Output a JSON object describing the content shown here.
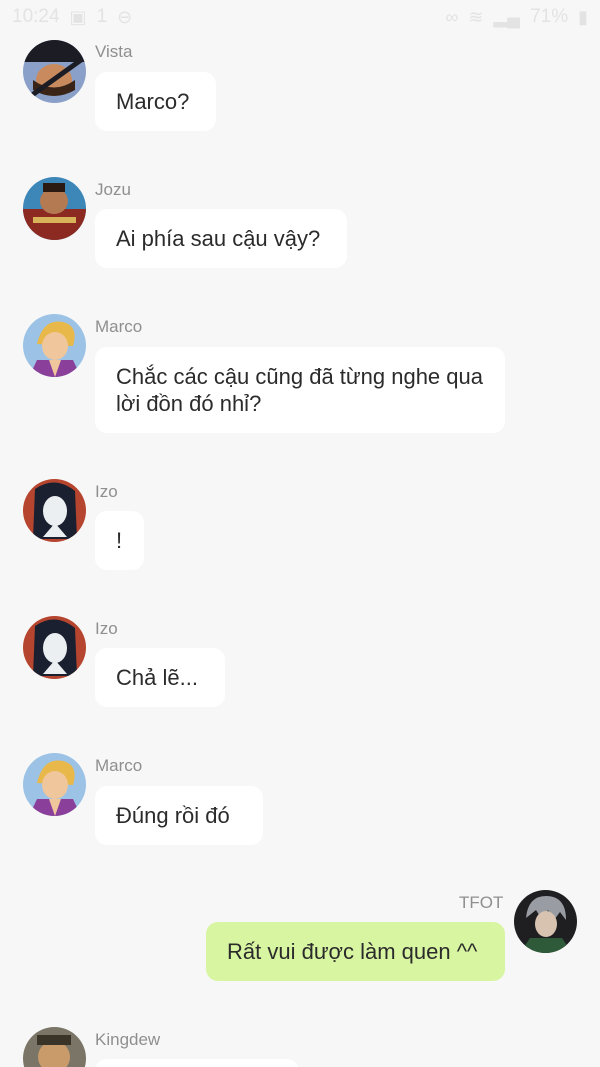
{
  "status_bar": {
    "time": "10:24",
    "notification_count": "1",
    "battery": "71%"
  },
  "messages": [
    {
      "sender": "Vista",
      "text": "Marco?"
    },
    {
      "sender": "Jozu",
      "text": "Ai phía sau cậu vậy?"
    },
    {
      "sender": "Marco",
      "text": "Chắc các cậu cũng đã từng nghe qua lời đồn đó nhỉ?"
    },
    {
      "sender": "Izo",
      "text": "!"
    },
    {
      "sender": "Izo",
      "text": "Chả lẽ..."
    },
    {
      "sender": "Marco",
      "text": "Đúng rồi đó"
    },
    {
      "sender": "TFOT",
      "text": "Rất vui được làm quen ^^"
    },
    {
      "sender": "Kingdew",
      "text": ""
    }
  ],
  "colors": {
    "background": "#f7f7f7",
    "incoming_bubble": "#ffffff",
    "outgoing_bubble": "#d8f5a2",
    "sender_name": "#8f8f8f"
  },
  "icons": [
    "image-icon",
    "sync-icon",
    "infinity-icon",
    "wifi-icon",
    "signal-icon",
    "battery-icon"
  ]
}
